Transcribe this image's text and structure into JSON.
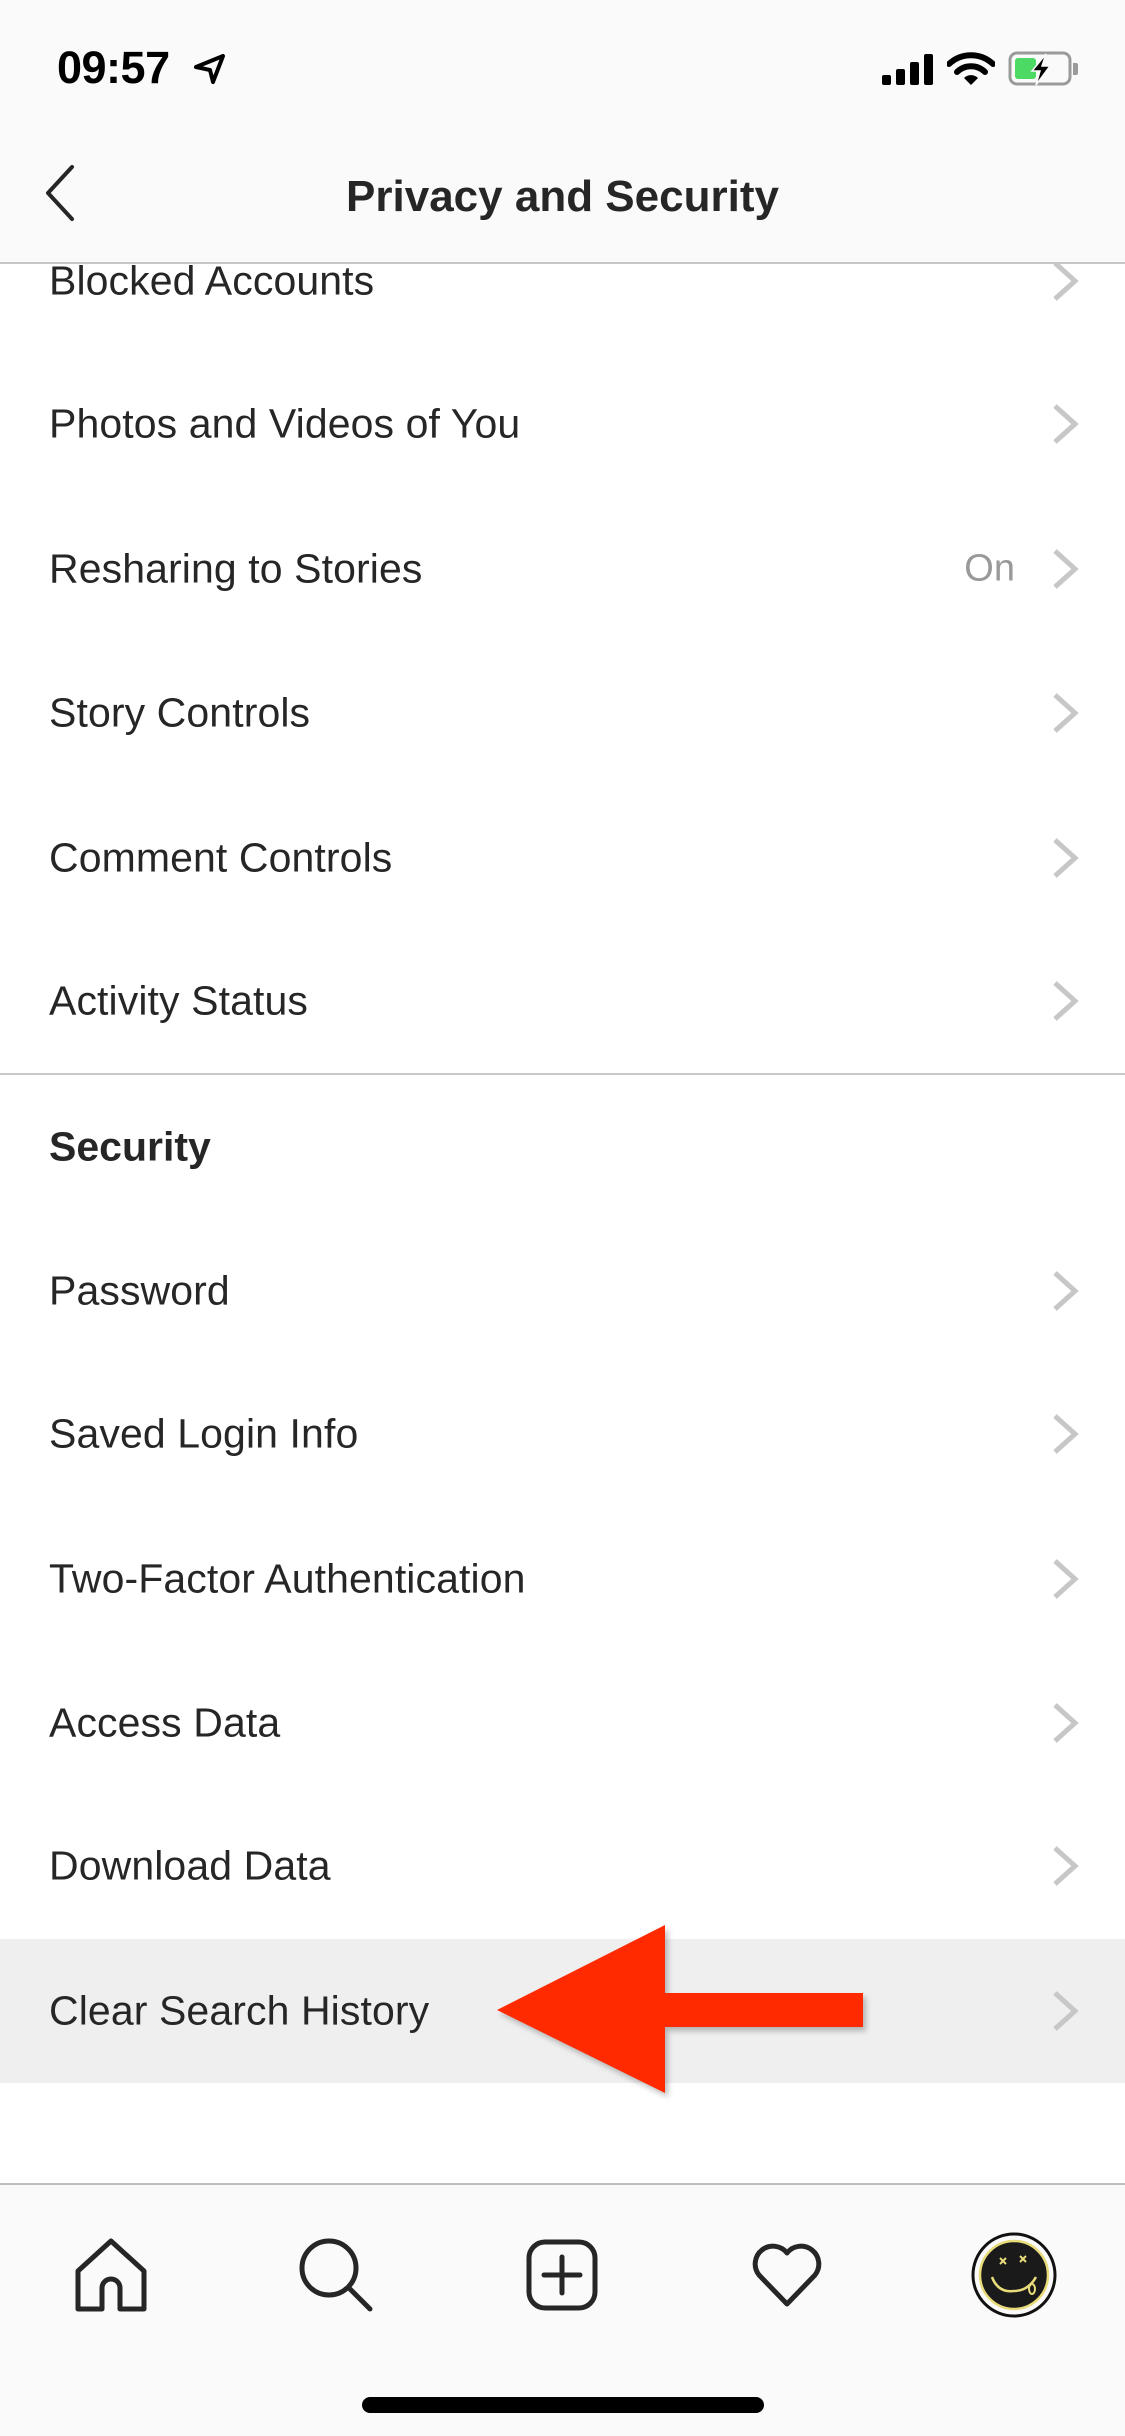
{
  "status_bar": {
    "time": "09:57",
    "location_icon": "location-arrow-icon",
    "signal_icon": "cellular-signal-icon",
    "wifi_icon": "wifi-icon",
    "battery_icon": "battery-charging-icon",
    "battery_level": 0.35
  },
  "header": {
    "back_icon": "chevron-left-icon",
    "title": "Privacy and Security"
  },
  "privacy_items": [
    {
      "label": "Blocked Accounts",
      "value": ""
    },
    {
      "label": "Photos and Videos of You",
      "value": ""
    },
    {
      "label": "Resharing to Stories",
      "value": "On"
    },
    {
      "label": "Story Controls",
      "value": ""
    },
    {
      "label": "Comment Controls",
      "value": ""
    },
    {
      "label": "Activity Status",
      "value": ""
    }
  ],
  "security_section": {
    "title": "Security",
    "items": [
      {
        "label": "Password"
      },
      {
        "label": "Saved Login Info"
      },
      {
        "label": "Two-Factor Authentication"
      },
      {
        "label": "Access Data"
      },
      {
        "label": "Download Data"
      },
      {
        "label": "Clear Search History",
        "highlighted": true
      }
    ]
  },
  "annotation": {
    "type": "arrow",
    "direction": "left",
    "points_to": "Clear Search History",
    "color": "#FF2A00"
  },
  "tab_bar": {
    "tabs": [
      {
        "name": "home",
        "icon": "home-icon"
      },
      {
        "name": "search",
        "icon": "search-icon"
      },
      {
        "name": "new-post",
        "icon": "plus-square-icon"
      },
      {
        "name": "activity",
        "icon": "heart-icon"
      },
      {
        "name": "profile",
        "icon": "avatar"
      }
    ]
  },
  "colors": {
    "text": "#262626",
    "secondary_text": "#999999",
    "chevron": "#C7C7C7",
    "highlight_row": "#EFEFEF",
    "bar_background": "#FAFAFA",
    "battery_green": "#4CD964"
  }
}
